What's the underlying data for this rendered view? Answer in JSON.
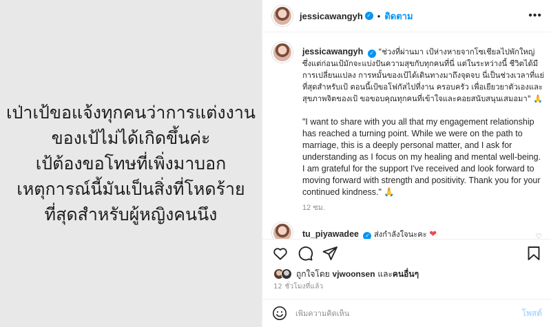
{
  "media": {
    "lines": [
      "เป่าเป้ขอแจ้งทุกคนว่าการแต่งงาน",
      "ของเป้ไม่ได้เกิดขึ้นค่ะ",
      "เป้ต้องขอโทษที่เพิ่งมาบอก",
      "เหตุการณ์นี้มันเป็นสิ่งที่โหดร้าย",
      "ที่สุดสำหรับผู้หญิงคนนึง"
    ]
  },
  "header": {
    "username": "jessicawangyh",
    "follow_label": "ติดตาม",
    "more_label": "•••"
  },
  "caption": {
    "username": "jessicawangyh",
    "thai_text": "\"ช่วงที่ผ่านมา เป้ห่างหายจากโซเชียลไปพักใหญ่ ซึ่งแต่ก่อนเป้มักจะแบ่งปันความสุขกับทุกคนที่นี่ แต่ในระหว่างนี้ ชีวิตได้มีการเปลี่ยนแปลง การหมั้นของเป้ได้เดินทางมาถึงจุดจบ นี่เป็นช่วงเวลาที่แย่ที่สุดสำหรับเป้ ตอนนี้เป้ขอโฟกัสไปที่งาน ครอบครัว เพื่อเยียวยาตัวเองและสุขภาพจิตของเป้ ขอขอบคุณทุกคนที่เข้าใจและคอยสนับสนุนเสมอมา\" 🙏",
    "english_text": "\"I want to share with you all that my engagement relationship has reached a turning point. While we were on the path to marriage, this is a deeply personal matter, and I ask for understanding as I focus on my healing and mental well-being. I am grateful for the support I've received and look forward to moving forward with strength and positivity. Thank you for your continued kindness.\" 🙏",
    "time": "12 ชม."
  },
  "comment": {
    "username": "tu_piyawadee",
    "text": "ส่งกำลังใจนะคะ",
    "heart": "❤"
  },
  "likes": {
    "prefix": "ถูกใจโดย",
    "user": "vjwoonsen",
    "connector": "และ",
    "others": "คนอื่นๆ"
  },
  "timestamp": "12 ชั่วโมงที่แล้ว",
  "add_comment": {
    "placeholder": "เพิ่มความคิดเห็น",
    "post_label": "โพสต์"
  },
  "colors": {
    "accent": "#0095f6",
    "heart": "#ed4956",
    "muted": "#8e8e8e"
  }
}
